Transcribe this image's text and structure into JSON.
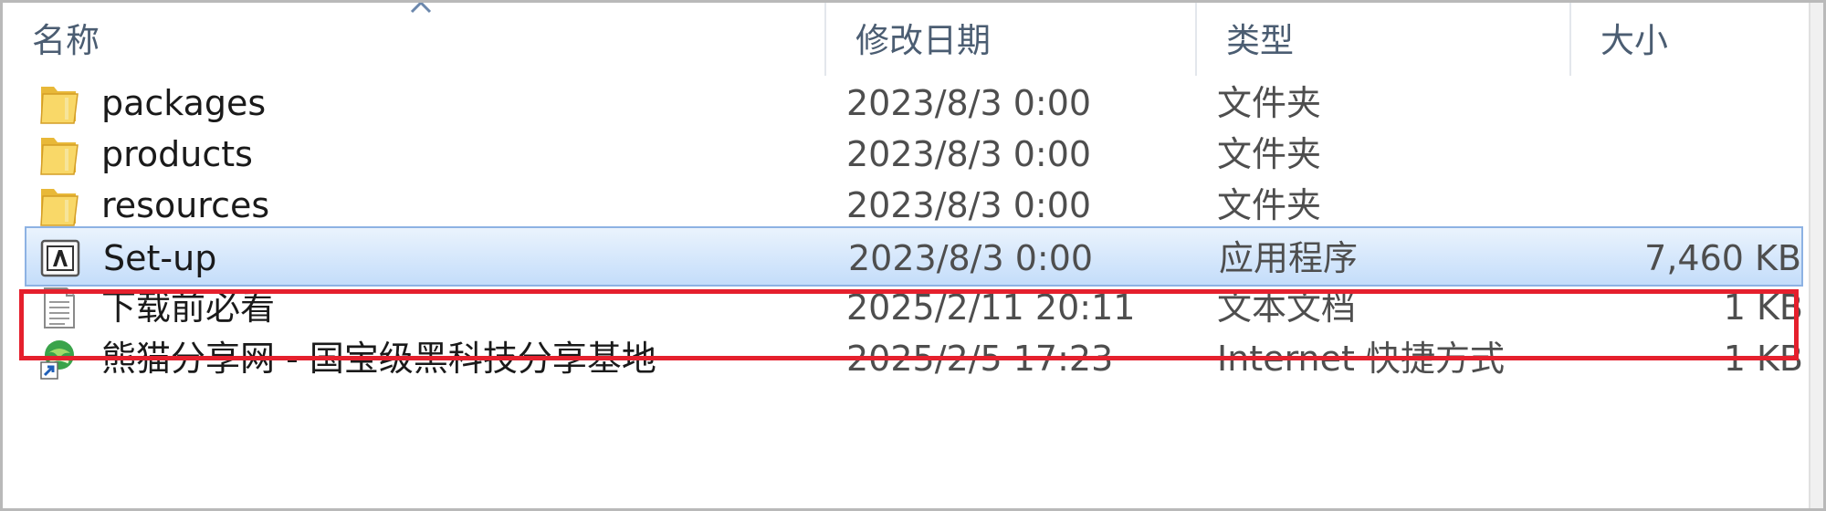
{
  "columns": {
    "name": "名称",
    "date": "修改日期",
    "type": "类型",
    "size": "大小"
  },
  "rows": [
    {
      "icon": "folder-icon",
      "name": "packages",
      "date": "2023/8/3 0:00",
      "type": "文件夹",
      "size": "",
      "selected": false
    },
    {
      "icon": "folder-icon",
      "name": "products",
      "date": "2023/8/3 0:00",
      "type": "文件夹",
      "size": "",
      "selected": false
    },
    {
      "icon": "folder-icon",
      "name": "resources",
      "date": "2023/8/3 0:00",
      "type": "文件夹",
      "size": "",
      "selected": false
    },
    {
      "icon": "adobe-app-icon",
      "name": "Set-up",
      "date": "2023/8/3 0:00",
      "type": "应用程序",
      "size": "7,460 KB",
      "selected": true
    },
    {
      "icon": "text-document-icon",
      "name": "下载前必看",
      "date": "2025/2/11 20:11",
      "type": "文本文档",
      "size": "1 KB",
      "selected": false
    },
    {
      "icon": "internet-shortcut-icon",
      "name": "熊猫分享网 - 国宝级黑科技分享基地",
      "date": "2025/2/5 17:23",
      "type": "Internet 快捷方式",
      "size": "1 KB",
      "selected": false
    }
  ],
  "colors": {
    "highlight": "#e5202d",
    "selection": "#c4ddfa",
    "header_text": "#4b5d72"
  }
}
